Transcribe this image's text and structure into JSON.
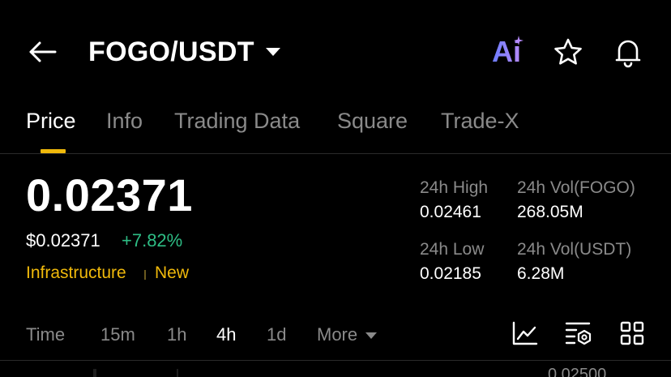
{
  "header": {
    "pair": "FOGO/USDT",
    "ai_label": "Ai"
  },
  "tabs": [
    "Price",
    "Info",
    "Trading Data",
    "Square",
    "Trade-X"
  ],
  "price": {
    "last": "0.02371",
    "usd": "$0.02371",
    "change": "+7.82%",
    "tags": [
      "Infrastructure",
      "New"
    ]
  },
  "stats": {
    "high_label": "24h High",
    "high_value": "0.02461",
    "vol_base_label": "24h Vol(FOGO)",
    "vol_base_value": "268.05M",
    "low_label": "24h Low",
    "low_value": "0.02185",
    "vol_quote_label": "24h Vol(USDT)",
    "vol_quote_value": "6.28M"
  },
  "intervals": {
    "items": [
      "Time",
      "15m",
      "1h",
      "4h",
      "1d"
    ],
    "selected": "4h",
    "more_label": "More"
  },
  "chart": {
    "top_tick": "0.02500"
  },
  "colors": {
    "accent": "#f0b90b",
    "positive": "#2ebd85",
    "muted": "#8a8a8a"
  }
}
